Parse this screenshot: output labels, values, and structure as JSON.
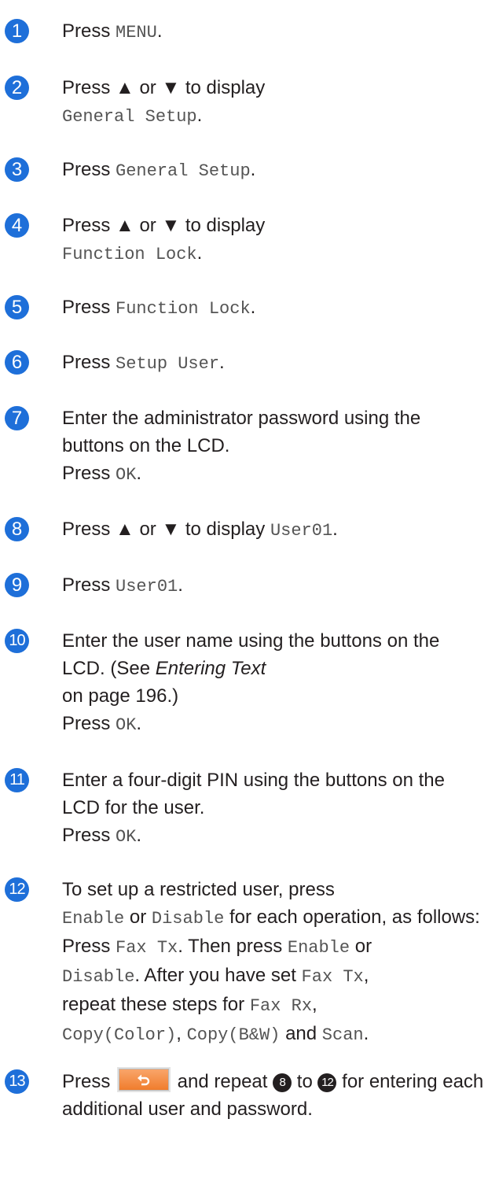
{
  "steps": [
    {
      "num": "1",
      "text": {
        "a": "Press ",
        "b": "MENU",
        "c": "."
      }
    },
    {
      "num": "2",
      "text": {
        "a": "Press ▲ or ▼ to display",
        "b": "General Setup",
        "c": "."
      }
    },
    {
      "num": "3",
      "text": {
        "a": "Press ",
        "b": "General Setup",
        "c": "."
      }
    },
    {
      "num": "4",
      "text": {
        "a": "Press ▲ or ▼ to display",
        "b": "Function Lock",
        "c": "."
      }
    },
    {
      "num": "5",
      "text": {
        "a": "Press ",
        "b": "Function Lock",
        "c": "."
      }
    },
    {
      "num": "6",
      "text": {
        "a": "Press ",
        "b": "Setup User",
        "c": "."
      }
    },
    {
      "num": "7",
      "text": {
        "a": "Enter the administrator password using the buttons on the LCD.",
        "b": "Press ",
        "c": "OK",
        "d": "."
      }
    },
    {
      "num": "8",
      "text": {
        "a": "Press ▲ or ▼ to display ",
        "b": "User01",
        "c": "."
      }
    },
    {
      "num": "9",
      "text": {
        "a": "Press ",
        "b": "User01",
        "c": "."
      }
    },
    {
      "num": "10",
      "text": {
        "a": "Enter the user name using the buttons on the LCD. (See ",
        "b": "Entering Text",
        "c": "on page 196.)",
        "d": "Press ",
        "e": "OK",
        "f": "."
      }
    },
    {
      "num": "11",
      "text": {
        "a": "Enter a four-digit PIN using the buttons on the LCD for the user.",
        "b": "Press ",
        "c": "OK",
        "d": "."
      }
    },
    {
      "num": "12",
      "text": {
        "a": "To set up a restricted user, press",
        "b": "Enable",
        "c": " or ",
        "d": "Disable",
        "e": " for each operation, as follows:",
        "f": "Press ",
        "g": "Fax Tx",
        "h": ". Then press ",
        "i": "Enable",
        "j": " or",
        "k": "Disable",
        "l": ". After you have set ",
        "m": "Fax Tx",
        "n": ",",
        "o": "repeat these steps for ",
        "p": "Fax Rx",
        "q": ",",
        "r": "Copy(Color)",
        "s": ", ",
        "t": "Copy(B&W)",
        "u": " and ",
        "v": "Scan",
        "w": "."
      }
    },
    {
      "num": "13",
      "text": {
        "a": "Press ",
        "b": " and repeat ",
        "c": "8",
        "d": " to ",
        "e": "12",
        "f": " for entering each additional user and password."
      }
    }
  ],
  "colors": {
    "step_circle": "#1e6fd9",
    "text": "#231f20",
    "mono_text": "#545454",
    "back_button": "#f07d2d"
  },
  "icons": {
    "back_button": "back-arrow-icon"
  }
}
